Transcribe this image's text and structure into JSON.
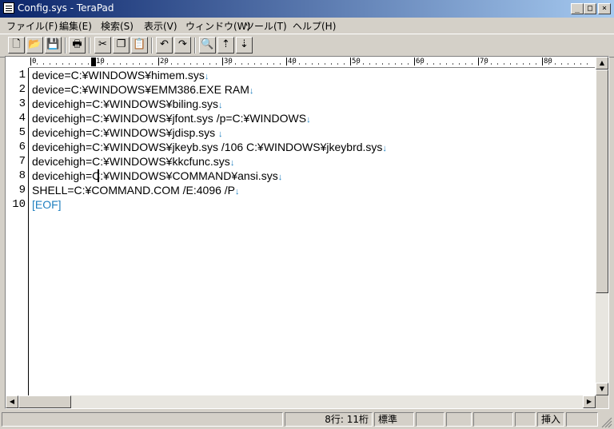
{
  "window": {
    "title": "Config.sys - TeraPad",
    "minimize": "_",
    "maximize": "□",
    "close": "×"
  },
  "menu": [
    {
      "label": "ファイル(F)"
    },
    {
      "label": "編集(E)"
    },
    {
      "label": "検索(S)"
    },
    {
      "label": "表示(V)"
    },
    {
      "label": "ウィンドウ(W)"
    },
    {
      "label": "ツール(T)"
    },
    {
      "label": "ヘルプ(H)"
    }
  ],
  "toolbar": {
    "new_icon": "🗋",
    "open_icon": "📂",
    "save_icon": "💾",
    "print_icon": "🖶",
    "cut_icon": "✂",
    "copy_icon": "❐",
    "paste_icon": "📋",
    "undo_icon": "↶",
    "redo_icon": "↷",
    "find_icon": "🔍",
    "find_prev_icon": "⇡",
    "find_next_icon": "⇣"
  },
  "ruler": {
    "marks": [
      "0",
      "10",
      "20",
      "30",
      "40",
      "50",
      "60",
      "70",
      "80"
    ]
  },
  "editor": {
    "lines": [
      {
        "num": "1",
        "text": "device=C:¥WINDOWS¥himem.sys",
        "nl": "↓"
      },
      {
        "num": "2",
        "text": "device=C:¥WINDOWS¥EMM386.EXE RAM",
        "nl": "↓"
      },
      {
        "num": "3",
        "text": "devicehigh=C:¥WINDOWS¥biling.sys",
        "nl": "↓"
      },
      {
        "num": "4",
        "text": "devicehigh=C:¥WINDOWS¥jfont.sys /p=C:¥WINDOWS",
        "nl": "↓"
      },
      {
        "num": "5",
        "text": "devicehigh=C:¥WINDOWS¥jdisp.sys ",
        "nl": "↓"
      },
      {
        "num": "6",
        "text": "devicehigh=C:¥WINDOWS¥jkeyb.sys /106 C:¥WINDOWS¥jkeybrd.sys",
        "nl": "↓"
      },
      {
        "num": "7",
        "text": "devicehigh=C:¥WINDOWS¥kkcfunc.sys",
        "nl": "↓"
      },
      {
        "num": "8",
        "text": "devicehigh=C:¥WINDOWS¥COMMAND¥ansi.sys",
        "nl": "↓"
      },
      {
        "num": "9",
        "text": "SHELL=C:¥COMMAND.COM /E:4096 /P",
        "nl": "↓"
      },
      {
        "num": "10",
        "text": "[EOF]",
        "nl": ""
      }
    ]
  },
  "scroll": {
    "up": "▲",
    "down": "▼",
    "left": "◀",
    "right": "▶"
  },
  "status": {
    "position": "8行:  11桁",
    "mode": "標準",
    "insert": "挿入"
  }
}
